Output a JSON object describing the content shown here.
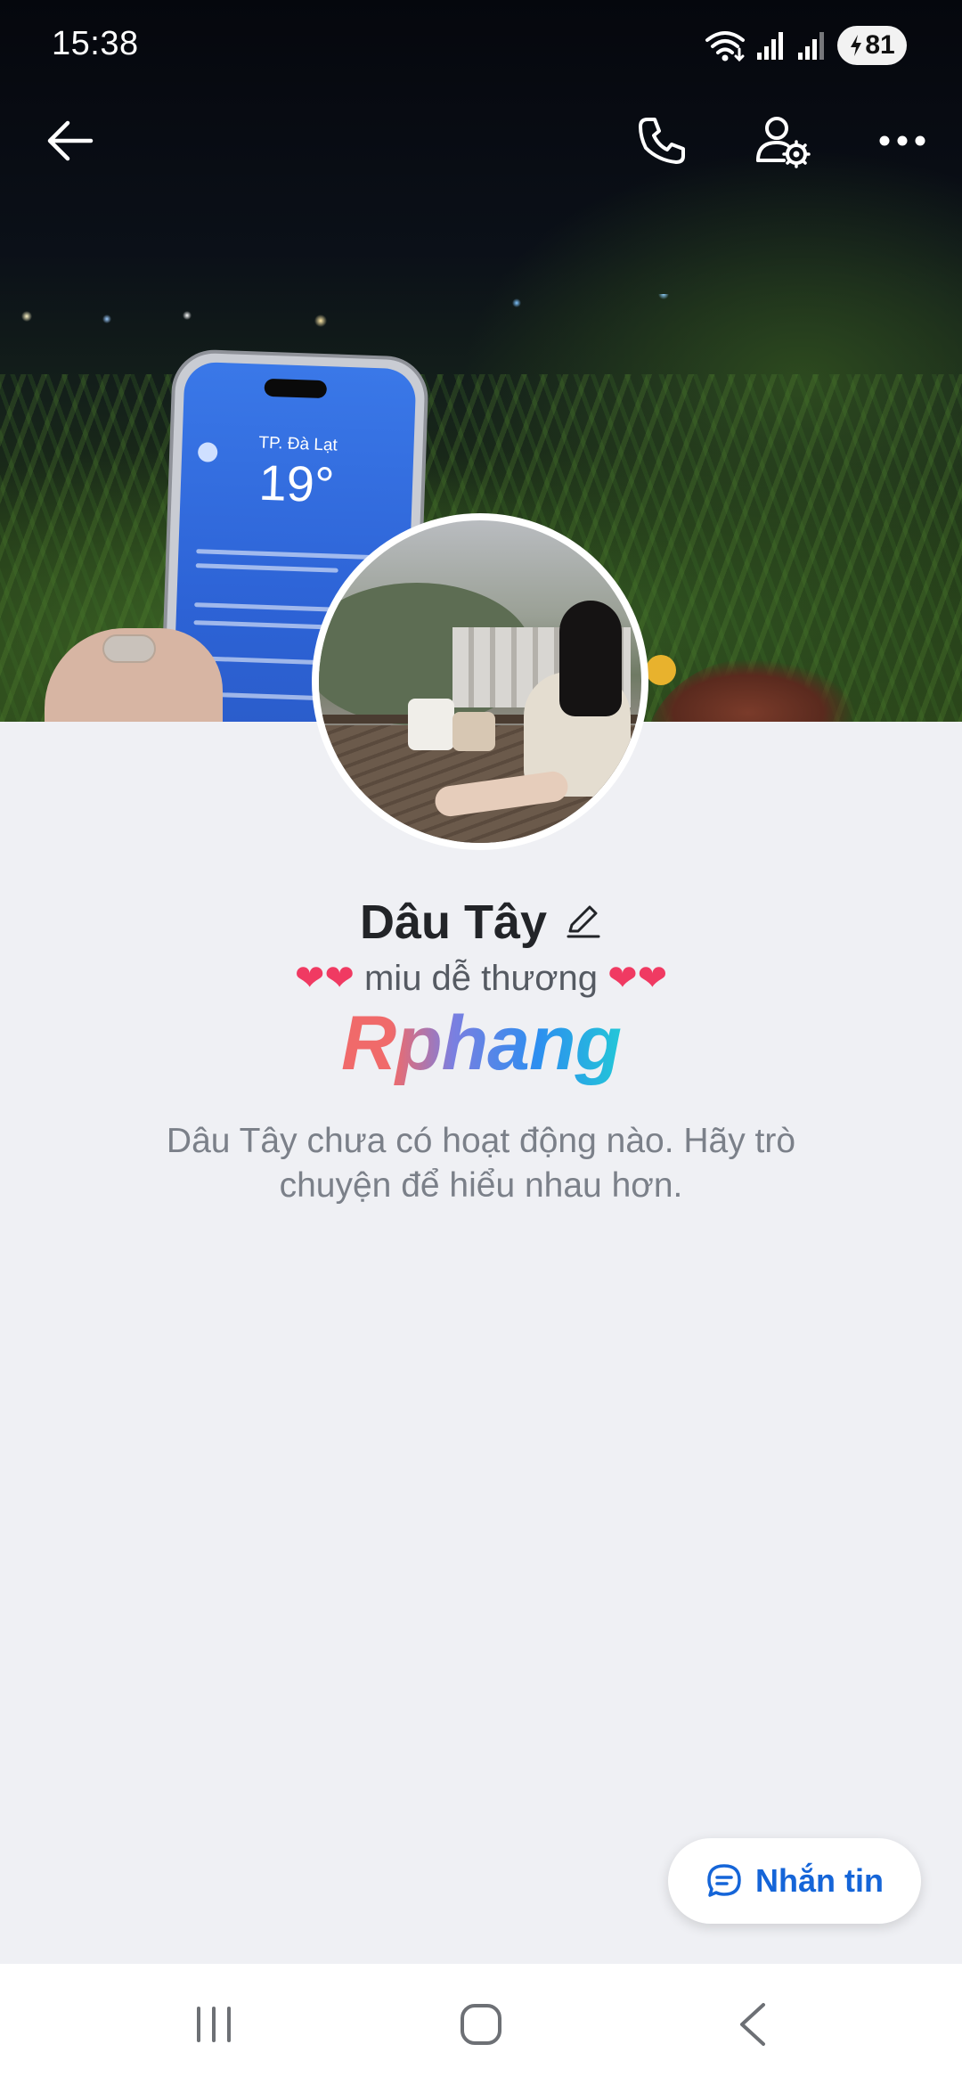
{
  "status_bar": {
    "time": "15:38",
    "battery_level": "81",
    "icons": [
      "wifi-icon",
      "cellular-signal-icon",
      "cellular-signal-icon",
      "battery-charging-icon"
    ]
  },
  "top_bar": {
    "icons": [
      "back-arrow-icon",
      "phone-call-icon",
      "user-settings-icon",
      "more-options-icon"
    ]
  },
  "profile": {
    "name": "Dâu Tây",
    "bio_hearts_left": "❤❤",
    "bio_text": "miu dễ thương",
    "bio_hearts_right": "❤❤",
    "brand_logo_text": "Rphang",
    "activity_message": "Dâu Tây chưa có hoạt động nào. Hãy trò chuyện để hiểu nhau hơn.",
    "cover_photo_text": {
      "city": "TP. Đà Lạt",
      "temperature": "19°"
    }
  },
  "message_button": {
    "label": "Nhắn tin",
    "icon": "chat-bubble-icon"
  },
  "nav_bar": {
    "icons": [
      "recent-apps-icon",
      "home-icon",
      "back-icon"
    ]
  },
  "colors": {
    "background": "#eff0f4",
    "accent": "#1565d8",
    "name_text": "#222428",
    "secondary_text": "#7b8089",
    "heart": "#f03a62"
  }
}
